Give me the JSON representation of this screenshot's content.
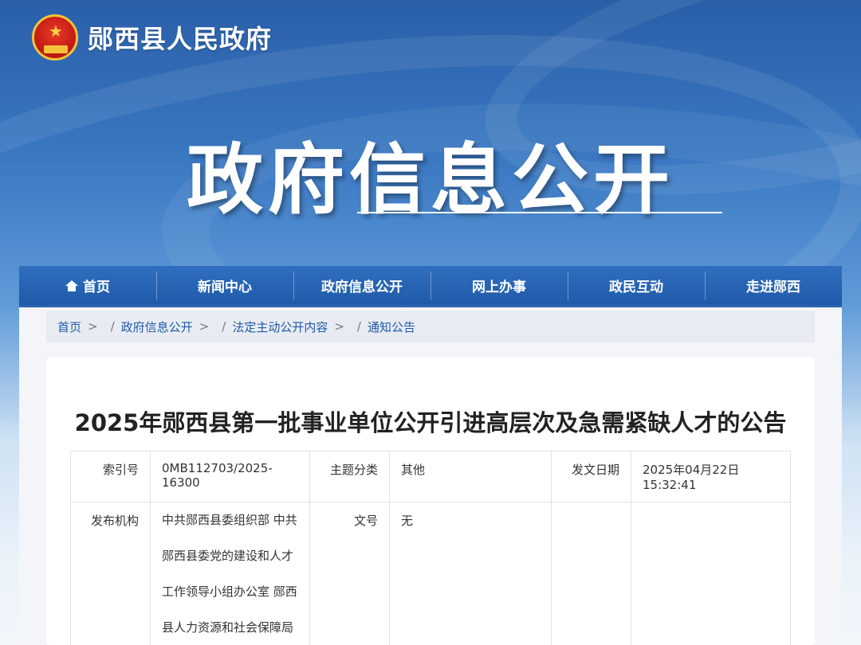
{
  "header": {
    "site_name": "郧西县人民政府",
    "hero_title": "政府信息公开"
  },
  "nav": {
    "items": [
      {
        "label": "首页",
        "icon": "home-icon"
      },
      {
        "label": "新闻中心"
      },
      {
        "label": "政府信息公开"
      },
      {
        "label": "网上办事"
      },
      {
        "label": "政民互动"
      },
      {
        "label": "走进郧西"
      }
    ]
  },
  "breadcrumb": {
    "items": [
      "首页",
      "政府信息公开",
      "法定主动公开内容",
      "通知公告"
    ],
    "separator": ">",
    "slash": "/"
  },
  "article": {
    "title": "2025年郧西县第一批事业单位公开引进高层次及急需紧缺人才的公告",
    "meta": {
      "index_label": "索引号",
      "index_value": "0MB112703/2025-16300",
      "topic_label": "主题分类",
      "topic_value": "其他",
      "date_label": "发文日期",
      "date_value": "2025年04月22日 15:32:41",
      "org_label": "发布机构",
      "org_value": "中共郧西县委组织部 中共郧西县委党的建设和人才工作领导小组办公室 郧西县人力资源和社会保障局",
      "doc_no_label": "文号",
      "doc_no_value": "无"
    }
  },
  "colors": {
    "nav_bg": "#1f5aa8",
    "link": "#1f5aa8",
    "emblem_red": "#c41d14",
    "emblem_gold": "#f3c33a"
  }
}
